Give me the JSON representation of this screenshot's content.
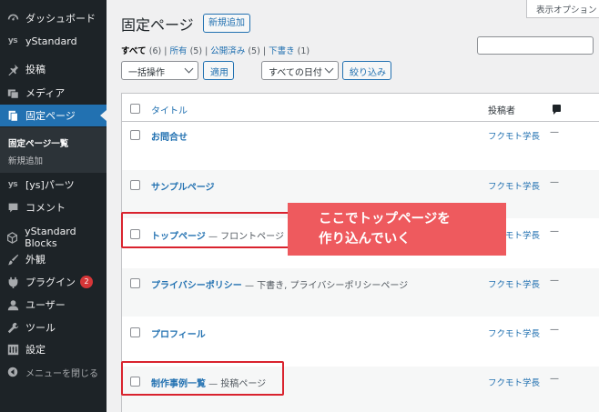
{
  "sidebar": {
    "items": [
      {
        "label": "ダッシュボード",
        "icon": "dashboard-icon"
      },
      {
        "label": "yStandard",
        "icon": "ys-icon"
      },
      {
        "label": "投稿",
        "icon": "pin-icon"
      },
      {
        "label": "メディア",
        "icon": "media-icon"
      },
      {
        "label": "固定ページ",
        "icon": "page-icon"
      },
      {
        "label": "[ys]パーツ",
        "icon": "ys-icon"
      },
      {
        "label": "コメント",
        "icon": "comment-icon"
      },
      {
        "label": "yStandard Blocks",
        "icon": "cube-icon"
      },
      {
        "label": "外観",
        "icon": "brush-icon"
      },
      {
        "label": "プラグイン",
        "icon": "plugin-icon",
        "badge": "2"
      },
      {
        "label": "ユーザー",
        "icon": "user-icon"
      },
      {
        "label": "ツール",
        "icon": "wrench-icon"
      },
      {
        "label": "設定",
        "icon": "settings-icon"
      }
    ],
    "ys_glyph": "ys",
    "submenu": {
      "all_pages": "固定ページ一覧",
      "add_new": "新規追加"
    },
    "collapse_label": "メニューを閉じる"
  },
  "header": {
    "title": "固定ページ",
    "add_new": "新規追加",
    "screen_options": "表示オプション"
  },
  "filters": {
    "all": {
      "label": "すべて",
      "count": "(6)"
    },
    "mine": {
      "label": "所有",
      "count": "(5)"
    },
    "published": {
      "label": "公開済み",
      "count": "(5)"
    },
    "draft": {
      "label": "下書き",
      "count": "(1)"
    },
    "separator": "|"
  },
  "bulk_actions": {
    "selected": "一括操作",
    "apply": "適用"
  },
  "date_filter": {
    "selected": "すべての日付",
    "filter": "絞り込み"
  },
  "table": {
    "columns": {
      "title": "タイトル",
      "author": "投稿者"
    },
    "rows": [
      {
        "title": "お問合せ",
        "state": "",
        "author": "フクモト学長",
        "comments": "—"
      },
      {
        "title": "サンプルページ",
        "state": "",
        "author": "フクモト学長",
        "comments": "—"
      },
      {
        "title": "トップページ",
        "state": " — フロントページ",
        "author": "フクモト学長",
        "comments": "—"
      },
      {
        "title": "プライバシーポリシー",
        "state": " — 下書き, プライバシーポリシーページ",
        "author": "フクモト学長",
        "comments": "—"
      },
      {
        "title": "プロフィール",
        "state": "",
        "author": "フクモト学長",
        "comments": "—"
      },
      {
        "title": "制作事例一覧",
        "state": " — 投稿ページ",
        "author": "フクモト学長",
        "comments": "—"
      }
    ]
  },
  "callout": {
    "line1": "ここでトップページを",
    "line2": "作り込んでいく"
  },
  "colors": {
    "accent": "#2271b1",
    "sidebar_bg": "#1d2327",
    "annotation_red": "#d9232e",
    "callout_bg": "#ee5a5e"
  }
}
